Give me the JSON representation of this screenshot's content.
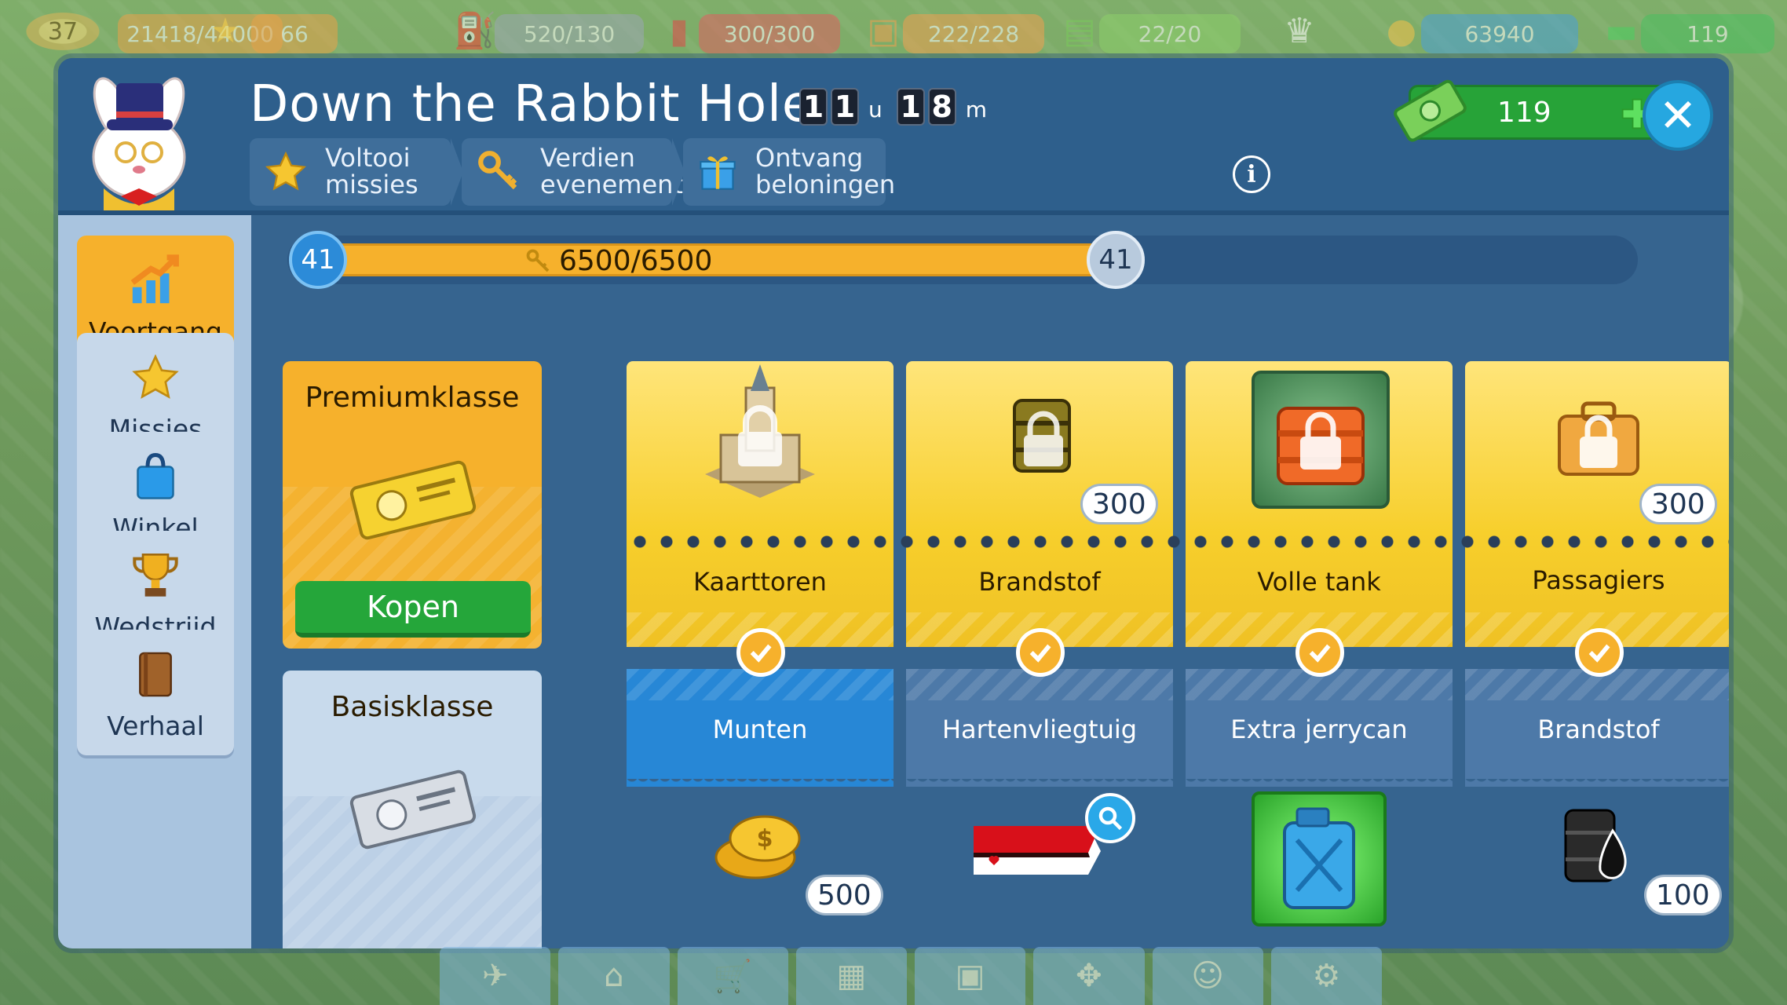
{
  "topbar": {
    "level": "37",
    "xp": "21418/44000",
    "stars": "66",
    "fuel": "520/130",
    "jerrycan": "300/300",
    "cargo": "222/228",
    "passengers": "22/20",
    "coins": "63940",
    "cash": "119"
  },
  "header": {
    "title": "Down the Rabbit Hole",
    "timer": {
      "hours_digits": [
        "1",
        "1"
      ],
      "hours_unit": "u",
      "minutes_digits": [
        "1",
        "8"
      ],
      "minutes_unit": "m"
    },
    "tabs": [
      {
        "label": "Voltooi missies",
        "icon": "star-icon"
      },
      {
        "label": "Verdien evenementvaluta",
        "label_line1": "Verdien",
        "label_line2": "evenementvaluta",
        "icon": "key-icon"
      },
      {
        "label": "Ontvang beloningen",
        "icon": "gift-icon"
      }
    ],
    "cash_value": "119"
  },
  "sidenav": [
    {
      "label": "Voortgang",
      "icon": "progress-chart-icon",
      "active": true
    },
    {
      "label": "Missies",
      "icon": "star-icon",
      "active": false
    },
    {
      "label": "Winkel",
      "icon": "shopping-bag-icon",
      "active": false
    },
    {
      "label": "Wedstrijd",
      "icon": "trophy-icon",
      "active": false
    },
    {
      "label": "Verhaal",
      "icon": "book-icon",
      "active": false
    }
  ],
  "progress": {
    "current_level": "41",
    "next_level": "41",
    "text": "6500/6500",
    "fraction": 1.0
  },
  "premium": {
    "title": "Premiumklasse",
    "buy_label": "Kopen"
  },
  "basic": {
    "title": "Basisklasse"
  },
  "rewards": [
    {
      "premium_label": "Kaarttoren",
      "premium_amount": "",
      "premium_icon": "control-tower-icon",
      "basic_label": "Munten",
      "basic_amount": "500",
      "basic_icon": "coins-icon",
      "claimed": true
    },
    {
      "premium_label": "Brandstof",
      "premium_amount": "300",
      "premium_icon": "fuel-barrel-icon",
      "basic_label": "Hartenvliegtuig",
      "basic_amount": "",
      "basic_icon": "heart-plane-icon",
      "claimed": true
    },
    {
      "premium_label": "Volle tank",
      "premium_amount": "",
      "premium_icon": "full-tank-icon",
      "basic_label": "Extra jerrycan",
      "basic_amount": "",
      "basic_icon": "jerrycan-icon",
      "claimed": true
    },
    {
      "premium_label": "Passagiers",
      "premium_amount": "300",
      "premium_icon": "suitcase-icon",
      "basic_label": "Brandstof",
      "basic_amount": "100",
      "basic_icon": "oil-drop-icon",
      "claimed": true
    }
  ],
  "colors": {
    "panel_blue": "#3a6690",
    "accent_orange": "#f6b12c",
    "buy_green": "#25a63a",
    "close_blue": "#26a7e0"
  }
}
